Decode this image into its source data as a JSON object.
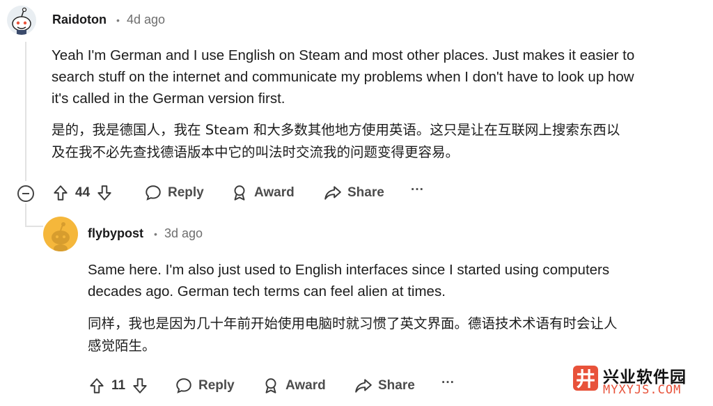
{
  "comment1": {
    "username": "Raidoton",
    "separator": "•",
    "time": "4d ago",
    "text_en": [
      "Yeah I'm German and I use English on Steam and most other places. Just makes it easier to",
      "search stuff on the internet and communicate my problems when I don't have to look up how",
      "it's called in the German version first."
    ],
    "text_zh": [
      "是的，我是德国人，我在 Steam 和大多数其他地方使用英语。这只是让在互联网上搜索东西以",
      "及在我不必先查找德语版本中它的叫法时交流我的问题变得更容易。"
    ],
    "votes": "44",
    "actions": {
      "reply": "Reply",
      "award": "Award",
      "share": "Share",
      "more": "···"
    }
  },
  "comment2": {
    "username": "flybypost",
    "separator": "•",
    "time": "3d ago",
    "text_en": [
      "Same here. I'm also just used to English interfaces since I started using computers",
      "decades ago. German tech terms can feel alien at times."
    ],
    "text_zh": [
      "同样，我也是因为几十年前开始使用电脑时就习惯了英文界面。德语技术术语有时会让人",
      "感觉陌生。"
    ],
    "votes": "11",
    "actions": {
      "reply": "Reply",
      "award": "Award",
      "share": "Share",
      "more": "···"
    }
  },
  "watermark": {
    "logo_glyph": "井",
    "name_cn": "兴业软件园",
    "name_en": "MYXYJS.COM"
  },
  "colors": {
    "accent": "#e8523a",
    "avatar2": "#f5b73b"
  }
}
